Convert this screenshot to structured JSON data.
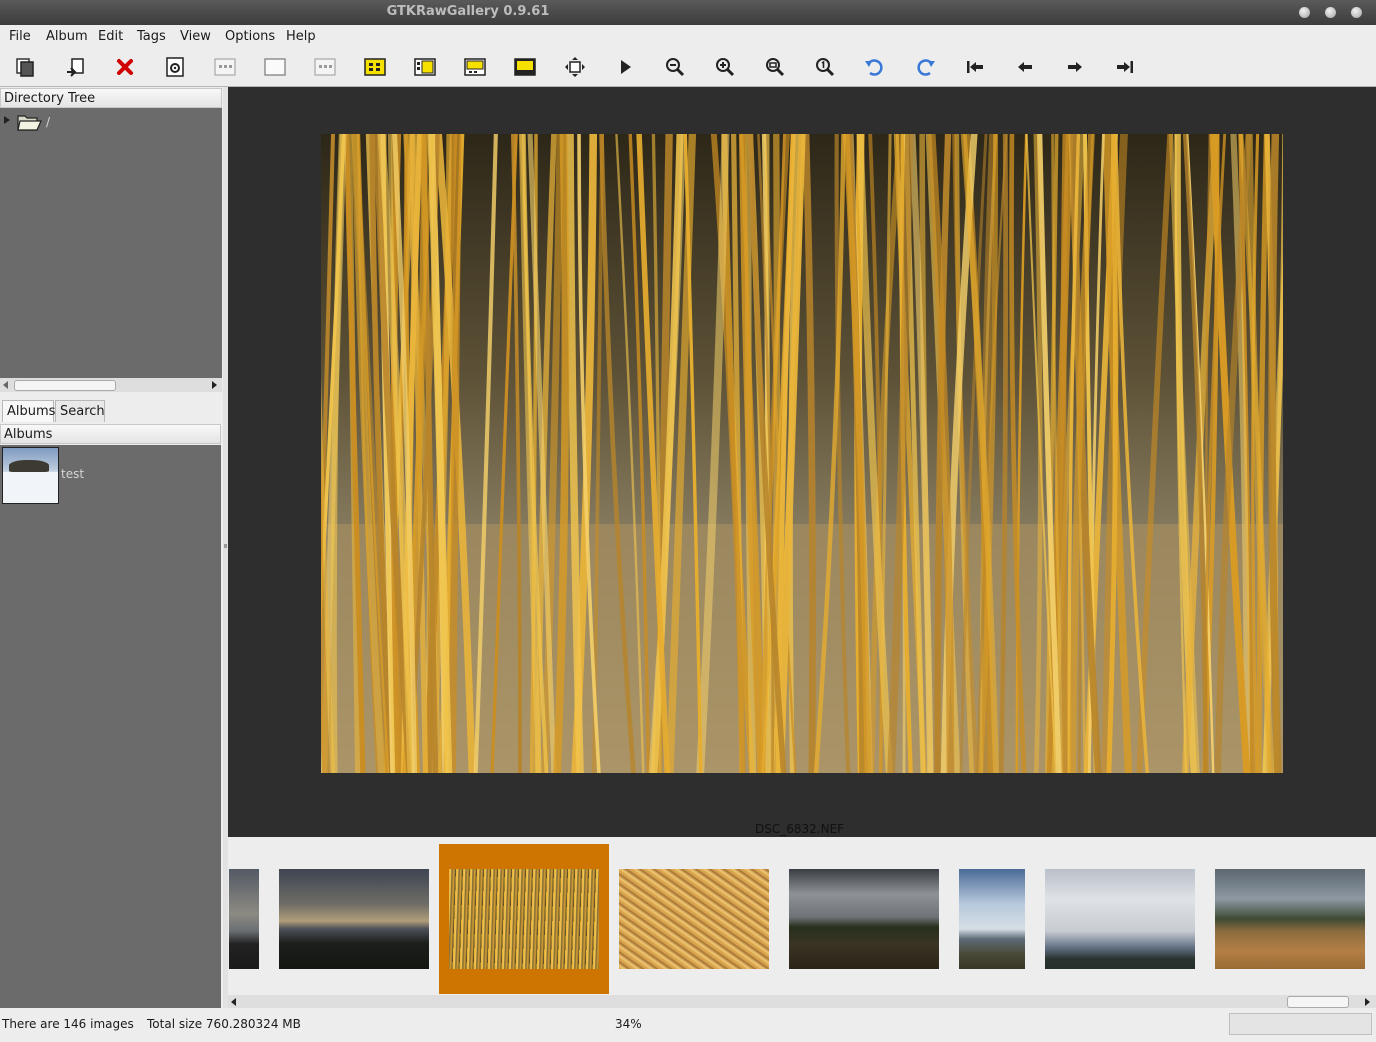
{
  "window": {
    "title": "GTKRawGallery 0.9.61"
  },
  "menu": [
    "File",
    "Album",
    "Edit",
    "Tags",
    "View",
    "Options",
    "Help"
  ],
  "toolbar": [
    "copy-icon",
    "import-icon",
    "delete-icon",
    "settings-icon",
    "grid-view-icon",
    "single-view-icon",
    "thumbnail-grid-icon",
    "layout-sidebar-icon",
    "layout-split-icon",
    "layout-top-icon",
    "layout-fullstrip-icon",
    "fullscreen-icon",
    "slideshow-play-icon",
    "zoom-out-icon",
    "zoom-in-icon",
    "zoom-fit-icon",
    "zoom-100-icon",
    "rotate-left-icon",
    "rotate-right-icon",
    "first-image-icon",
    "previous-image-icon",
    "next-image-icon",
    "last-image-icon"
  ],
  "sidebar": {
    "tree_header": "Directory Tree",
    "tree_root": "/",
    "tabs": [
      "Albums",
      "Search"
    ],
    "albums_header": "Albums",
    "album_name": "test"
  },
  "viewer": {
    "filename": "DSC_6832.NEF",
    "zoom": "34%"
  },
  "filmstrip": {
    "selected_index": 2,
    "thumbnails": [
      "dusk-hills",
      "yellow-grass-reeds",
      "orange-grass-tuft",
      "cloudy-field-trees",
      "blue-sky-hills",
      "cloudy-valley",
      "autumn-meadow-pines"
    ]
  },
  "status": {
    "count": "There are 146 images",
    "size": "Total size 760.280324 MB",
    "zoom": "34%"
  },
  "colors": {
    "selection": "#ce7400",
    "grass": "#e6ad2f",
    "pane_bg": "#6b6b6b",
    "viewer_bg": "#2e2e2e"
  }
}
